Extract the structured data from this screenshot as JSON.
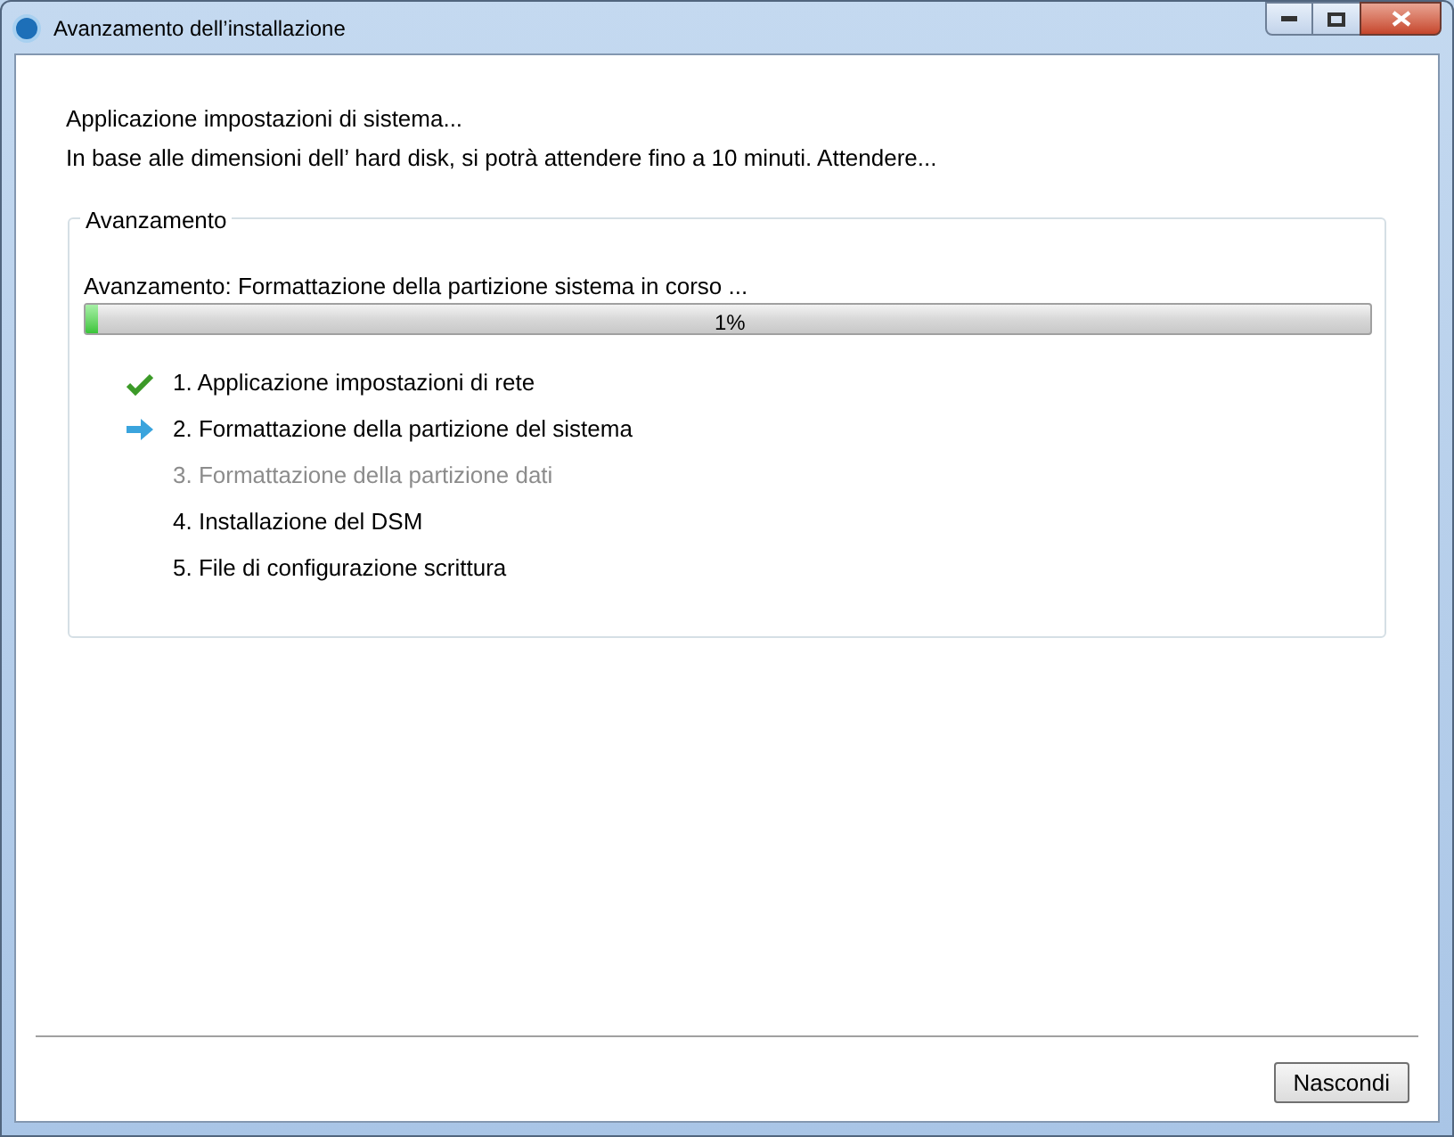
{
  "window": {
    "title": "Avanzamento dell’installazione"
  },
  "intro": [
    "Applicazione impostazioni di sistema...",
    "In base alle dimensioni dell’ hard disk, si potrà attendere fino a 10 minuti. Attendere..."
  ],
  "group": {
    "title": "Avanzamento",
    "status_text": "Avanzamento: Formattazione della partizione sistema in corso ...",
    "progress": {
      "level": 0.01,
      "reading": "1%"
    },
    "steps": [
      {
        "label": "1. Applicazione impostazioni di rete",
        "kind": "done",
        "disabled": false
      },
      {
        "label": "2. Formattazione della partizione del sistema",
        "kind": "current",
        "disabled": false
      },
      {
        "label": "3. Formattazione della partizione dati",
        "kind": "pending",
        "disabled": true
      },
      {
        "label": "4. Installazione del DSM",
        "kind": "pending",
        "disabled": false
      },
      {
        "label": "5. File di configurazione scrittura",
        "kind": "pending",
        "disabled": false
      }
    ]
  },
  "buttons": [
    "Nascondi"
  ]
}
